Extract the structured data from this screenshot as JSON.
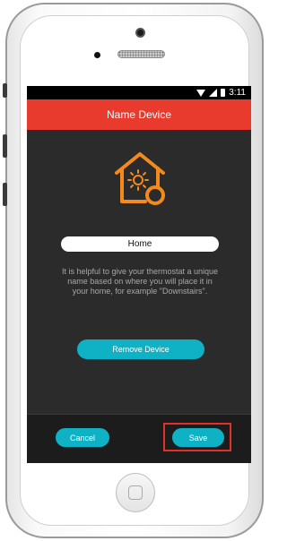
{
  "status_bar": {
    "time": "3:11"
  },
  "header": {
    "title": "Name Device"
  },
  "device_name": {
    "value": "Home"
  },
  "help_text": "It is helpful to give your thermostat a unique name based on where you will place it in your home, for example \"Downstairs\".",
  "actions": {
    "remove_label": "Remove Device",
    "cancel_label": "Cancel",
    "save_label": "Save"
  },
  "colors": {
    "header": "#e83a2d",
    "accent": "#0fb2c4",
    "icon": "#f48a1c",
    "highlight": "#e0312a",
    "background": "#2b2b2b"
  },
  "icons": [
    "house-sun-icon",
    "wifi-icon",
    "signal-icon",
    "battery-icon"
  ]
}
